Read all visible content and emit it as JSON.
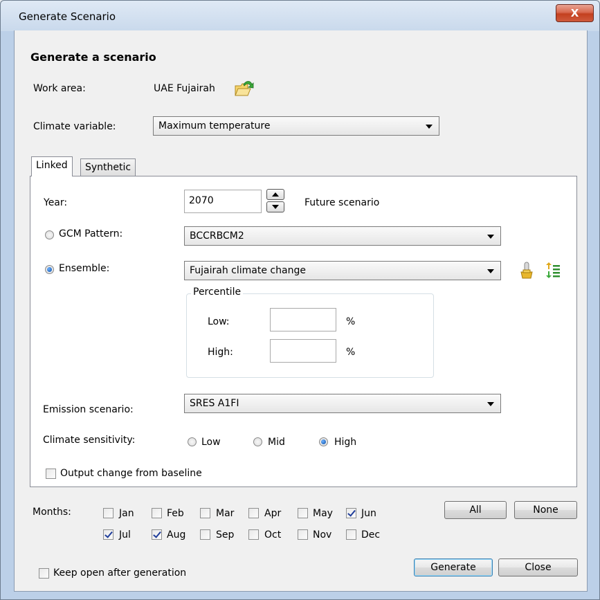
{
  "window": {
    "title": "Generate Scenario",
    "close_glyph": "X"
  },
  "heading": "Generate a scenario",
  "work_area": {
    "label": "Work area:",
    "value": "UAE Fujairah",
    "icon": "open-folder-icon"
  },
  "climate_variable": {
    "label": "Climate variable:",
    "selected": "Maximum temperature"
  },
  "tabs": [
    {
      "label": "Linked",
      "active": true
    },
    {
      "label": "Synthetic",
      "active": false
    }
  ],
  "linked": {
    "year": {
      "label": "Year:",
      "value": "2070",
      "note": "Future scenario"
    },
    "gcm_pattern": {
      "label": "GCM Pattern:",
      "selected": "BCCRBCM2",
      "checked": false
    },
    "ensemble": {
      "label": "Ensemble:",
      "selected": "Fujairah climate change",
      "checked": true
    },
    "percentile": {
      "title": "Percentile",
      "low_label": "Low:",
      "low_value": "",
      "high_label": "High:",
      "high_value": "",
      "unit": "%"
    },
    "emission": {
      "label": "Emission scenario:",
      "selected": "SRES A1FI"
    },
    "sensitivity": {
      "label": "Climate sensitivity:",
      "options": [
        "Low",
        "Mid",
        "High"
      ],
      "selected": "High"
    },
    "output_change": {
      "label": "Output change from baseline",
      "checked": false
    }
  },
  "months": {
    "label": "Months:",
    "items": [
      {
        "label": "Jan",
        "checked": false
      },
      {
        "label": "Feb",
        "checked": false
      },
      {
        "label": "Mar",
        "checked": false
      },
      {
        "label": "Apr",
        "checked": false
      },
      {
        "label": "May",
        "checked": false
      },
      {
        "label": "Jun",
        "checked": true
      },
      {
        "label": "Jul",
        "checked": true
      },
      {
        "label": "Aug",
        "checked": true
      },
      {
        "label": "Sep",
        "checked": false
      },
      {
        "label": "Oct",
        "checked": false
      },
      {
        "label": "Nov",
        "checked": false
      },
      {
        "label": "Dec",
        "checked": false
      }
    ],
    "all_button": "All",
    "none_button": "None"
  },
  "keep_open": {
    "label": "Keep open after generation",
    "checked": false
  },
  "buttons": {
    "generate": "Generate",
    "close": "Close"
  },
  "colors": {
    "accent": "#0a4fa8",
    "title_bar": "#c9d9ec",
    "close_button": "#c3401f"
  }
}
